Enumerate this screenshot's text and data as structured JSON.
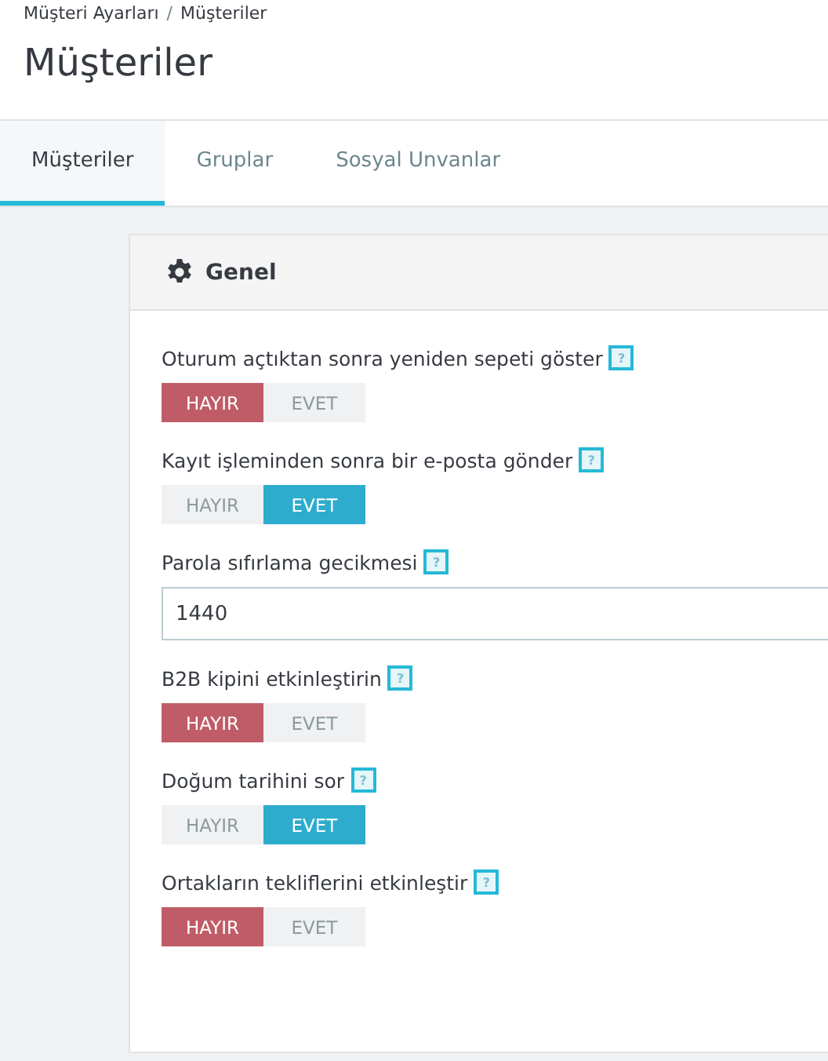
{
  "breadcrumb": [
    "Müşteri Ayarları",
    "Müşteriler"
  ],
  "breadcrumb_separator": "/",
  "title": "Müşteriler",
  "tabs": [
    {
      "label": "Müşteriler",
      "selected": true
    },
    {
      "label": "Gruplar",
      "selected": false
    },
    {
      "label": "Sosyal Unvanlar",
      "selected": false
    }
  ],
  "panel": {
    "title": "Genel",
    "fields": [
      {
        "kind": "switch",
        "label": "Oturum açtıktan sonra yeniden sepeti göster",
        "help": "?",
        "options": [
          {
            "label": "HAYIR",
            "selected": true
          },
          {
            "label": "EVET",
            "selected": false
          }
        ]
      },
      {
        "kind": "switch",
        "label": "Kayıt işleminden sonra bir e-posta gönder",
        "help": "?",
        "options": [
          {
            "label": "HAYIR",
            "selected": false
          },
          {
            "label": "EVET",
            "selected": true
          }
        ]
      },
      {
        "kind": "number",
        "label": "Parola sıfırlama gecikmesi",
        "help": "?",
        "value": "1440"
      },
      {
        "kind": "switch",
        "label": "B2B kipini etkinleştirin",
        "help": "?",
        "options": [
          {
            "label": "HAYIR",
            "selected": true
          },
          {
            "label": "EVET",
            "selected": false
          }
        ]
      },
      {
        "kind": "switch",
        "label": "Doğum tarihini sor",
        "help": "?",
        "options": [
          {
            "label": "HAYIR",
            "selected": false
          },
          {
            "label": "EVET",
            "selected": true
          }
        ]
      },
      {
        "kind": "switch",
        "label": "Ortakların tekliflerini etkinleştir",
        "help": "?",
        "options": [
          {
            "label": "HAYIR",
            "selected": true
          },
          {
            "label": "EVET",
            "selected": false
          }
        ]
      }
    ]
  }
}
